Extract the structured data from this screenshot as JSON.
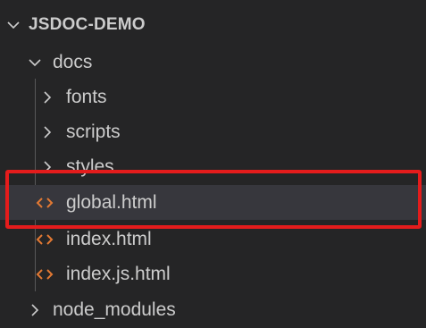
{
  "explorer": {
    "section_title": "JSDOC-DEMO",
    "items": [
      {
        "label": "docs",
        "kind": "folder",
        "state": "expanded",
        "depth": 1
      },
      {
        "label": "fonts",
        "kind": "folder",
        "state": "collapsed",
        "depth": 2
      },
      {
        "label": "scripts",
        "kind": "folder",
        "state": "collapsed",
        "depth": 2
      },
      {
        "label": "styles",
        "kind": "folder",
        "state": "collapsed",
        "depth": 2
      },
      {
        "label": "global.html",
        "kind": "file",
        "icon": "html-file-icon",
        "depth": 2,
        "selected": true
      },
      {
        "label": "index.html",
        "kind": "file",
        "icon": "html-file-icon",
        "depth": 2
      },
      {
        "label": "index.js.html",
        "kind": "file",
        "icon": "html-file-icon",
        "depth": 2
      },
      {
        "label": "node_modules",
        "kind": "folder",
        "state": "collapsed",
        "depth": 1
      }
    ]
  },
  "colors": {
    "background": "#252526",
    "selected_row": "#37373d",
    "text": "#cccccc",
    "html_icon": "#e37933",
    "annotation_box": "#e41c1c",
    "indent_guide": "#585858"
  },
  "annotation": {
    "target": "global.html"
  }
}
